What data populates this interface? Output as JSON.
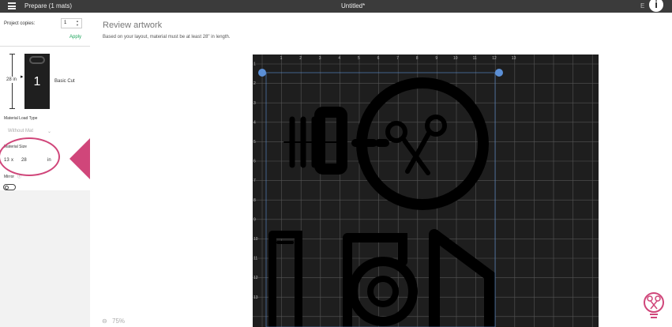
{
  "topbar": {
    "title": "Prepare (1 mats)",
    "document_title": "Untitled*",
    "right_text": "E",
    "info_label": "i"
  },
  "sidebar": {
    "project_copies_label": "Project copies:",
    "project_copies_value": "1",
    "apply_label": "Apply",
    "mat_height_label": "28 in",
    "mat_number": "1",
    "cut_type": "Basic Cut",
    "material_load_type_label": "Material Load Type",
    "material_load_type_value": "Without Mat",
    "material_size_label": "Material Size",
    "material_width": "13",
    "material_size_x": "x",
    "material_height": "28",
    "material_unit": "in",
    "mirror_label": "Mirror",
    "mirror_on": false
  },
  "main": {
    "title": "Review artwork",
    "subtitle": "Based on your layout, material must be at least 28\" in length.",
    "zoom": "75%",
    "ruler_top": [
      "1",
      "2",
      "3",
      "4",
      "5",
      "6",
      "7",
      "8",
      "9",
      "10",
      "11",
      "12",
      "13"
    ],
    "ruler_left": [
      "1",
      "2",
      "3",
      "4",
      "5",
      "6",
      "7",
      "8",
      "9",
      "10",
      "11",
      "12",
      "13"
    ]
  },
  "colors": {
    "accent_green": "#1aa35a",
    "highlight_pink": "#d0467a",
    "mat_dark": "#1e1e1e",
    "topbar": "#3b3b3b",
    "handle_blue": "#5b8fd6"
  },
  "icons": [
    "menu-icon",
    "info-icon",
    "help-icon",
    "scissors-icon",
    "zoom-icon",
    "lightbulb-scissors-icon"
  ]
}
